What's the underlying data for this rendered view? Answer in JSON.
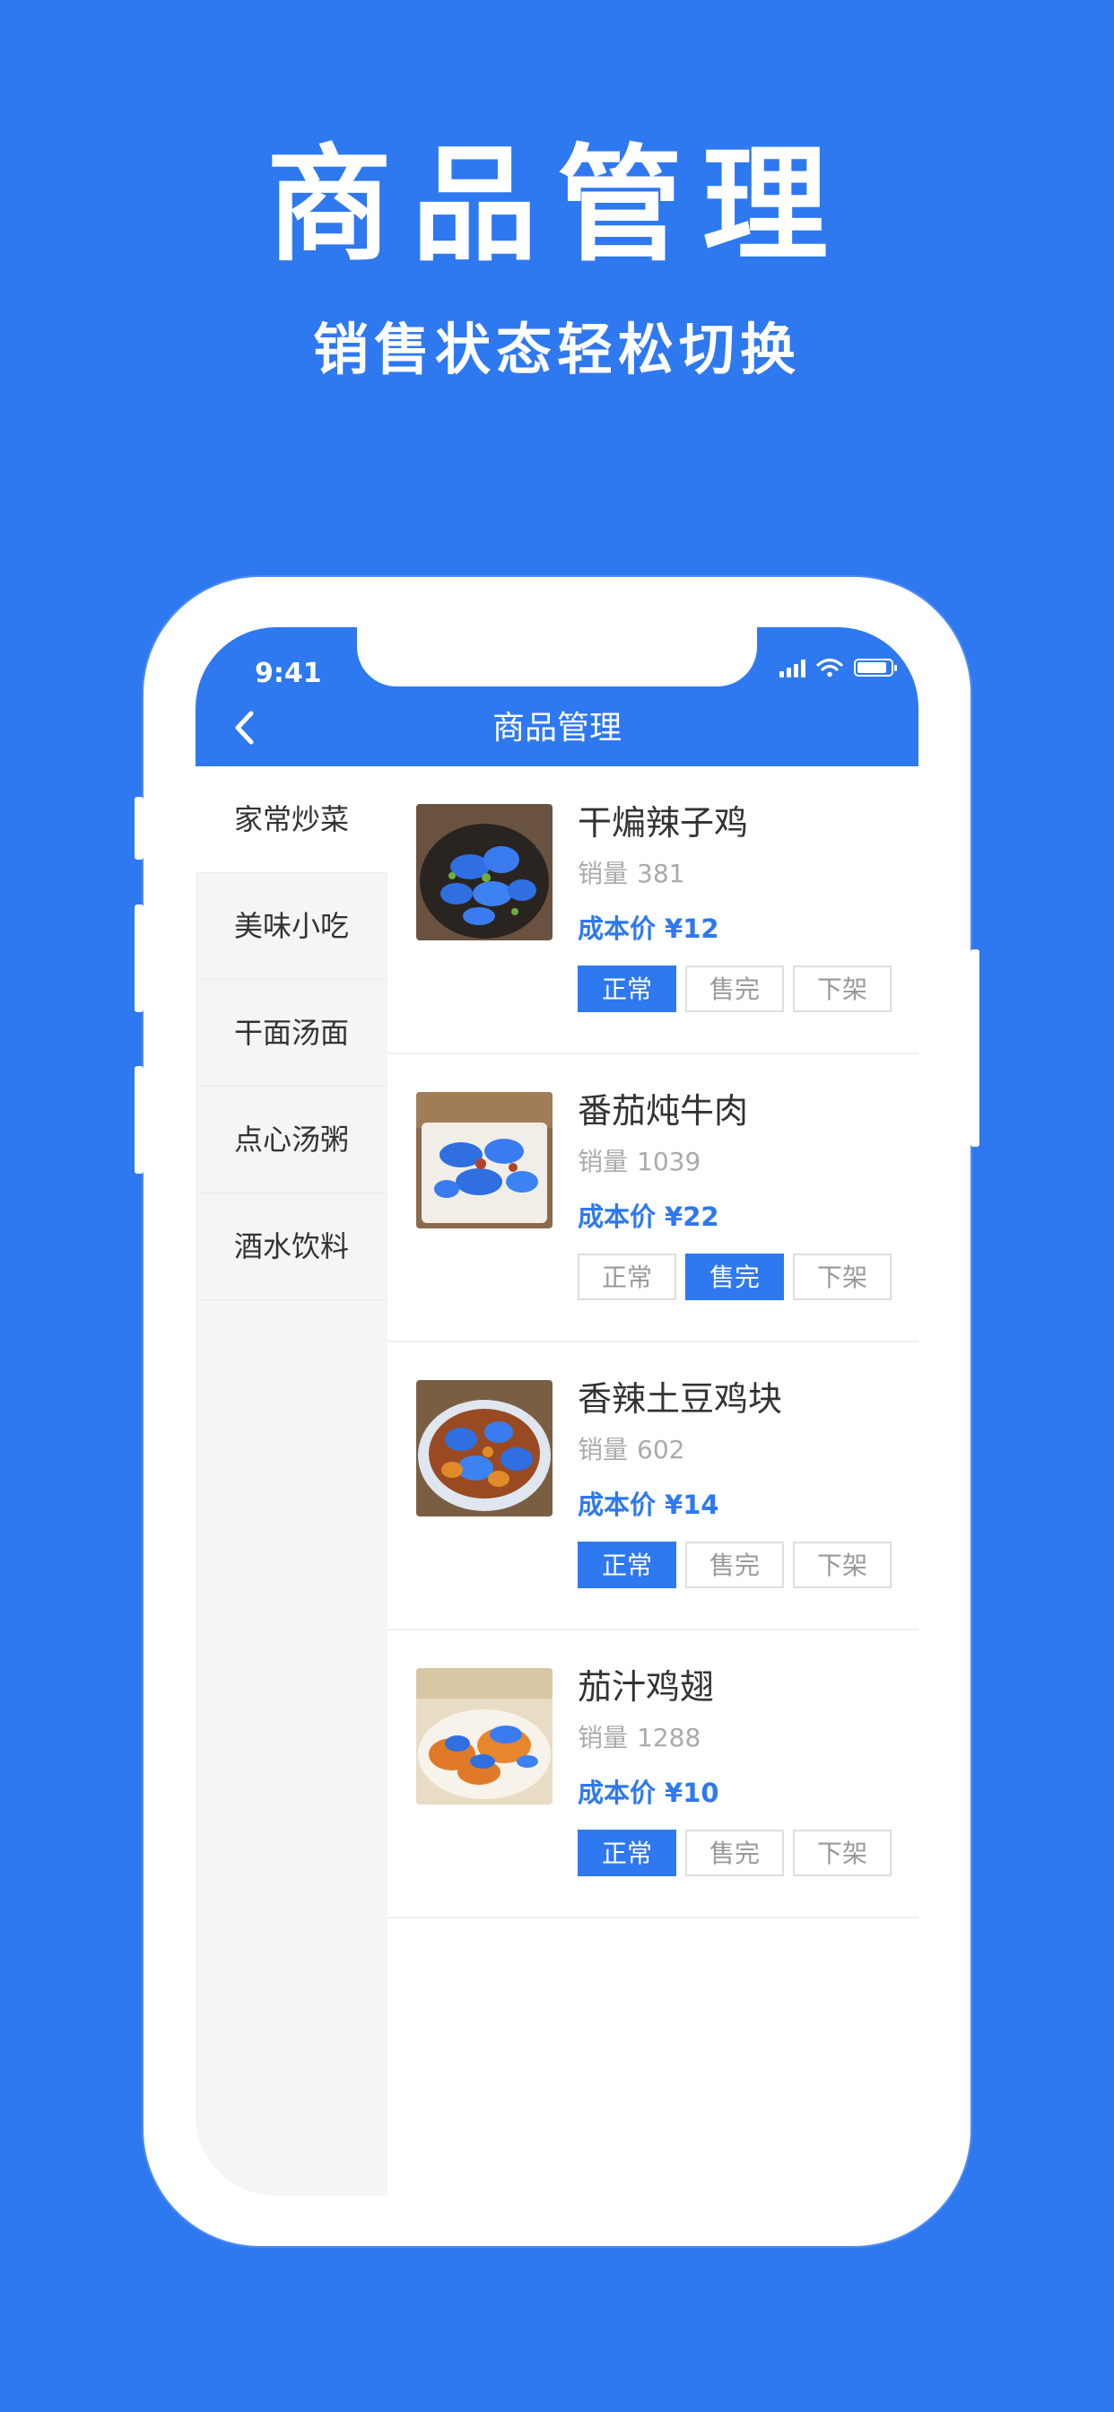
{
  "hero": {
    "title": "商品管理",
    "subtitle": "销售状态轻松切换"
  },
  "status_bar": {
    "time": "9:41"
  },
  "nav": {
    "title": "商品管理",
    "back_icon": "chevron-left-icon"
  },
  "categories": [
    {
      "label": "家常炒菜",
      "active": true
    },
    {
      "label": "美味小吃",
      "active": false
    },
    {
      "label": "干面汤面",
      "active": false
    },
    {
      "label": "点心汤粥",
      "active": false
    },
    {
      "label": "酒水饮料",
      "active": false
    }
  ],
  "products": [
    {
      "name": "干煸辣子鸡",
      "sales_label": "销量",
      "sales": "381",
      "price_label": "成本价",
      "price": "¥12",
      "status": "正常"
    },
    {
      "name": "番茄炖牛肉",
      "sales_label": "销量",
      "sales": "1039",
      "price_label": "成本价",
      "price": "¥22",
      "status": "售完"
    },
    {
      "name": "香辣土豆鸡块",
      "sales_label": "销量",
      "sales": "602",
      "price_label": "成本价",
      "price": "¥14",
      "status": "正常"
    },
    {
      "name": "茄汁鸡翅",
      "sales_label": "销量",
      "sales": "1288",
      "price_label": "成本价",
      "price": "¥10",
      "status": "正常"
    }
  ],
  "status_options": [
    "正常",
    "售完",
    "下架"
  ],
  "colors": {
    "brand": "#2e78f0",
    "background": "#2e78f0",
    "sidebar": "#f5f5f5"
  }
}
